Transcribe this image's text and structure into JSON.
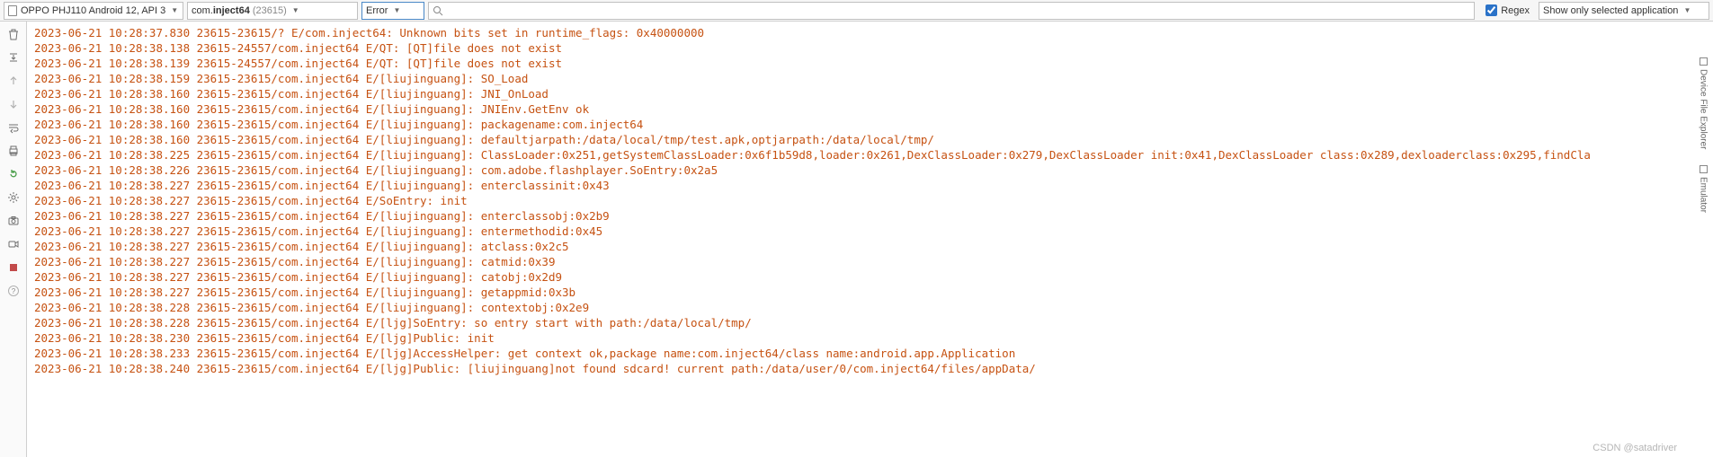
{
  "toolbar": {
    "device": "OPPO PHJ110 Android 12, API 3",
    "process_prefix": "com.",
    "process_bold": "inject64",
    "process_suffix": " (23615)",
    "level": "Error",
    "search_placeholder": "",
    "regex_label": "Regex",
    "scope": "Show only selected application"
  },
  "side": {
    "device_explorer": "Device File Explorer",
    "emulator": "Emulator"
  },
  "watermark": "CSDN @satadriver",
  "logs": [
    "2023-06-21 10:28:37.830 23615-23615/? E/com.inject64: Unknown bits set in runtime_flags: 0x40000000",
    "2023-06-21 10:28:38.138 23615-24557/com.inject64 E/QT: [QT]file does not exist",
    "2023-06-21 10:28:38.139 23615-24557/com.inject64 E/QT: [QT]file does not exist",
    "2023-06-21 10:28:38.159 23615-23615/com.inject64 E/[liujinguang]: SO_Load",
    "2023-06-21 10:28:38.160 23615-23615/com.inject64 E/[liujinguang]: JNI_OnLoad",
    "2023-06-21 10:28:38.160 23615-23615/com.inject64 E/[liujinguang]: JNIEnv.GetEnv ok",
    "2023-06-21 10:28:38.160 23615-23615/com.inject64 E/[liujinguang]: packagename:com.inject64",
    "2023-06-21 10:28:38.160 23615-23615/com.inject64 E/[liujinguang]: defaultjarpath:/data/local/tmp/test.apk,optjarpath:/data/local/tmp/",
    "2023-06-21 10:28:38.225 23615-23615/com.inject64 E/[liujinguang]: ClassLoader:0x251,getSystemClassLoader:0x6f1b59d8,loader:0x261,DexClassLoader:0x279,DexClassLoader init:0x41,DexClassLoader class:0x289,dexloaderclass:0x295,findCla",
    "2023-06-21 10:28:38.226 23615-23615/com.inject64 E/[liujinguang]: com.adobe.flashplayer.SoEntry:0x2a5",
    "2023-06-21 10:28:38.227 23615-23615/com.inject64 E/[liujinguang]: enterclassinit:0x43",
    "2023-06-21 10:28:38.227 23615-23615/com.inject64 E/SoEntry: init",
    "2023-06-21 10:28:38.227 23615-23615/com.inject64 E/[liujinguang]: enterclassobj:0x2b9",
    "2023-06-21 10:28:38.227 23615-23615/com.inject64 E/[liujinguang]: entermethodid:0x45",
    "2023-06-21 10:28:38.227 23615-23615/com.inject64 E/[liujinguang]: atclass:0x2c5",
    "2023-06-21 10:28:38.227 23615-23615/com.inject64 E/[liujinguang]: catmid:0x39",
    "2023-06-21 10:28:38.227 23615-23615/com.inject64 E/[liujinguang]: catobj:0x2d9",
    "2023-06-21 10:28:38.227 23615-23615/com.inject64 E/[liujinguang]: getappmid:0x3b",
    "2023-06-21 10:28:38.228 23615-23615/com.inject64 E/[liujinguang]: contextobj:0x2e9",
    "2023-06-21 10:28:38.228 23615-23615/com.inject64 E/[ljg]SoEntry: so entry start with path:/data/local/tmp/",
    "2023-06-21 10:28:38.230 23615-23615/com.inject64 E/[ljg]Public: init",
    "2023-06-21 10:28:38.233 23615-23615/com.inject64 E/[ljg]AccessHelper: get context ok,package name:com.inject64/class name:android.app.Application",
    "2023-06-21 10:28:38.240 23615-23615/com.inject64 E/[ljg]Public: [liujinguang]not found sdcard! current path:/data/user/0/com.inject64/files/appData/"
  ]
}
